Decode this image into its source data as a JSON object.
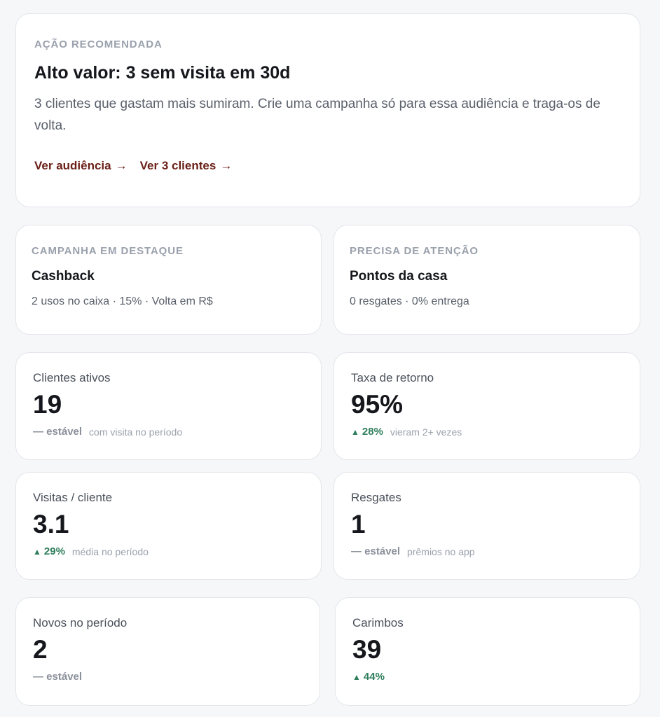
{
  "recommended": {
    "eyebrow": "AÇÃO RECOMENDADA",
    "title": "Alto valor: 3 sem visita em 30d",
    "description": "3 clientes que gastam mais sumiram. Crie uma campanha só para essa audiência e traga-os de volta.",
    "links": [
      {
        "label": "Ver audiência",
        "arrow": "→"
      },
      {
        "label": "Ver 3 clientes",
        "arrow": "→"
      }
    ]
  },
  "highlights": [
    {
      "eyebrow": "CAMPANHA EM DESTAQUE",
      "name": "Cashback",
      "meta": "2 usos no caixa · 15% · Volta em R$"
    },
    {
      "eyebrow": "PRECISA DE ATENÇÃO",
      "name": "Pontos da casa",
      "meta": "0 resgates · 0% entrega"
    }
  ],
  "metrics": [
    {
      "label": "Clientes ativos",
      "value": "19",
      "trend": "— estável",
      "trend_type": "flat",
      "sub": "com visita no período"
    },
    {
      "label": "Taxa de retorno",
      "value": "95%",
      "trend": "28%",
      "trend_type": "up",
      "sub": "vieram 2+ vezes"
    },
    {
      "label": "Visitas / cliente",
      "value": "3.1",
      "trend": "29%",
      "trend_type": "up",
      "sub": "média no período"
    },
    {
      "label": "Resgates",
      "value": "1",
      "trend": "— estável",
      "trend_type": "flat",
      "sub": "prêmios no app"
    },
    {
      "label": "Novos no período",
      "value": "2",
      "trend": "— estável",
      "trend_type": "flat",
      "sub": ""
    },
    {
      "label": "Carimbos",
      "value": "39",
      "trend": "44%",
      "trend_type": "up",
      "sub": ""
    }
  ],
  "colors": {
    "link": "#6b2018",
    "trend_up": "#2e7d5b",
    "trend_flat": "#8a909a"
  },
  "icons": {
    "link_arrow": "arrow-right-icon",
    "trend_up": "triangle-up-icon"
  }
}
